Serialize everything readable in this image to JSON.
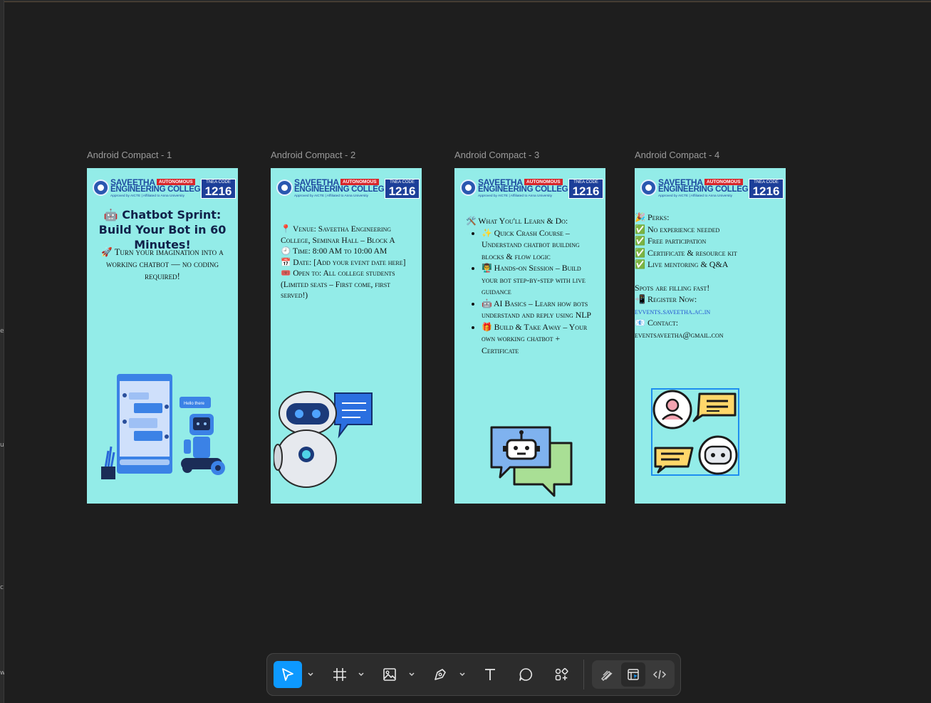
{
  "frames": [
    {
      "label": "Android Compact - 1"
    },
    {
      "label": "Android Compact - 2"
    },
    {
      "label": "Android Compact - 3"
    },
    {
      "label": "Android Compact - 4"
    }
  ],
  "logo": {
    "line1": "SAVEETHA",
    "autonomous": "AUTONOMOUS",
    "line2": "ENGINEERING COLLEGE",
    "line3": "Approved by AICTE | Affiliated to Anna University",
    "code_label": "TNEA CODE",
    "code_value": "1216"
  },
  "frame1": {
    "title": "🤖 Chatbot Sprint: Build Your Bot in 60 Minutes!",
    "subtitle": "🚀 Turn your imagination into a working chatbot — no coding required!",
    "illustration_bubble": "Hello there"
  },
  "frame2": {
    "venue": "📍 Venue: Saveetha Engineering College, Seminar Hall – Block A",
    "time": "🕘 Time: 8:00 AM to 10:00 AM",
    "date": "📅 Date: [Add your event date here]",
    "open_to": "🎟️ Open to: All college students (Limited seats – First come, first served!)"
  },
  "frame3": {
    "heading": "🛠️ What You'll Learn & Do:",
    "items": [
      "✨ Quick Crash Course – Understand chatbot building blocks & flow logic",
      "👨‍🏫 Hands-on Session – Build your bot step-by-step with live guidance",
      "🤖 AI Basics – Learn how bots understand and reply using NLP",
      "🎁 Build & Take Away – Your own working chatbot + Certificate"
    ]
  },
  "frame4": {
    "perks_heading": "🎉 Perks:",
    "perks": [
      "✅ No experience needed",
      "✅ Free participation",
      "✅ Certificate & resource kit",
      "✅ Live mentoring & Q&A"
    ],
    "spots": "Spots are filling fast!",
    "register_label": "📲 Register Now:",
    "register_link": "evvents.saveetha.ac.in",
    "contact_label": "📧 Contact:",
    "contact_value": "eventsaveetha@gmail.con"
  },
  "toolbar": {
    "tools": [
      "move-tool",
      "frame-tool",
      "image-tool",
      "pen-tool",
      "text-tool",
      "comment-tool",
      "actions-tool"
    ],
    "modes": [
      "draw-mode",
      "design-mode",
      "dev-mode"
    ],
    "accent": "#0d99ff"
  },
  "left_strip_marks": [
    "e",
    "u",
    "c",
    "w"
  ]
}
